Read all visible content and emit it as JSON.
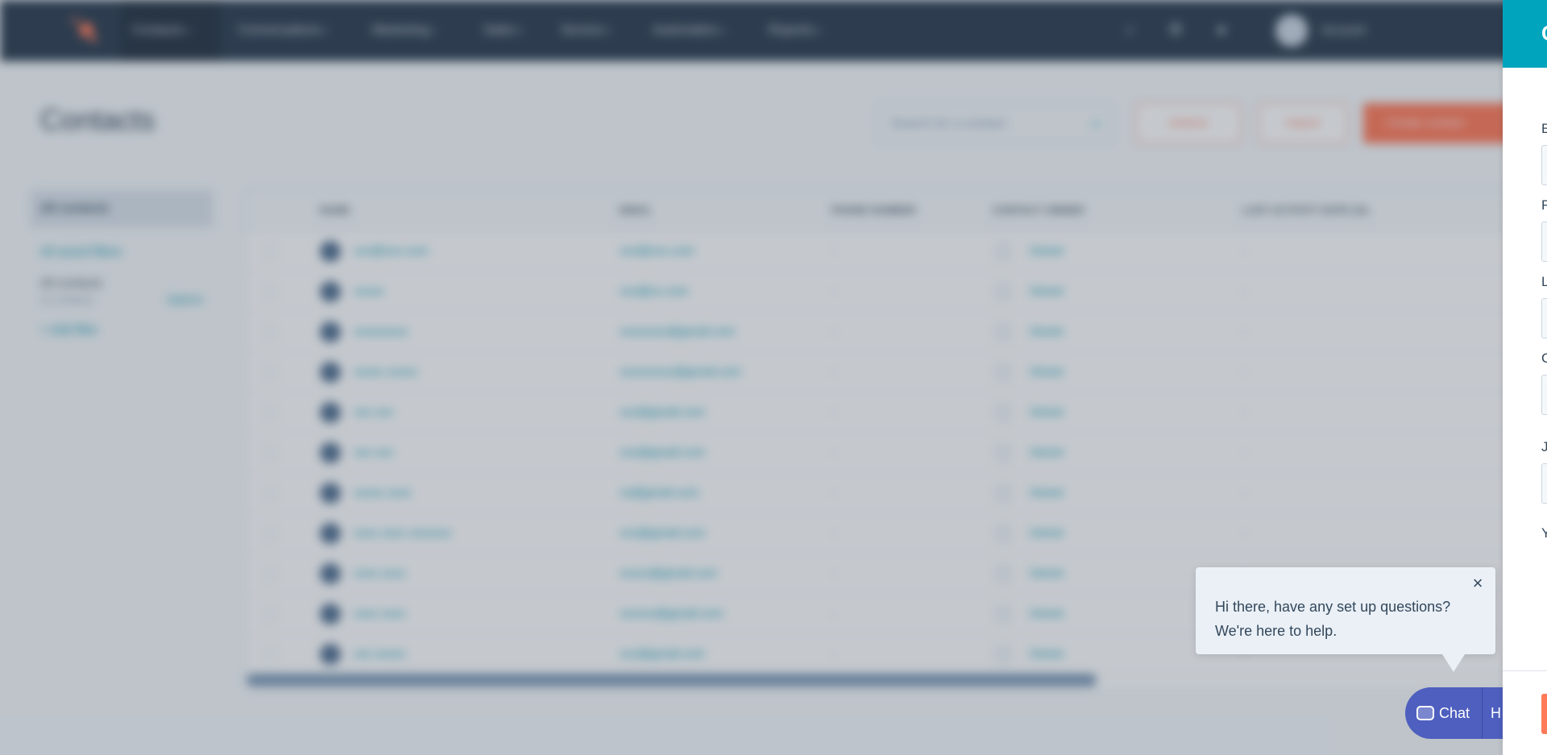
{
  "app": {
    "nav": {
      "items": [
        {
          "label": "Contacts"
        },
        {
          "label": "Conversations"
        },
        {
          "label": "Marketing"
        },
        {
          "label": "Sales"
        },
        {
          "label": "Service"
        },
        {
          "label": "Automation"
        },
        {
          "label": "Reports"
        }
      ],
      "account_label": "Account"
    },
    "page_title": "Contacts",
    "search_placeholder": "Search for a contact",
    "actions_label": "Actions",
    "import_label": "Import",
    "create_label": "Create contact",
    "left_panel": {
      "view_all": "All contacts",
      "saved_filters": "All saved filters",
      "filter_title": "All contacts",
      "filter_count": "11 contacts",
      "options": "Options",
      "add_filter": "+ Add filter"
    },
    "table": {
      "headers": [
        "NAME",
        "EMAIL",
        "PHONE NUMBER",
        "CONTACT OWNER",
        "LAST ACTIVITY DATE (GL"
      ],
      "rows": [
        {
          "name": "xxx@xxx.com",
          "email": "xxx@xxx.com",
          "phone": "-",
          "owner": "Owner",
          "activity": "-"
        },
        {
          "name": "xxxxx",
          "email": "xxx@xx.com",
          "phone": "-",
          "owner": "Owner",
          "activity": "-"
        },
        {
          "name": "xxxxxxxxx",
          "email": "xxxxxxxx@gmail.com",
          "phone": "-",
          "owner": "Owner",
          "activity": "-"
        },
        {
          "name": "xxxxx xxxxx",
          "email": "xxxxxxxxx@gmail.com",
          "phone": "-",
          "owner": "Owner",
          "activity": "-"
        },
        {
          "name": "xxx xxx",
          "email": "xxx@gmail.com",
          "phone": "-",
          "owner": "Owner",
          "activity": "-"
        },
        {
          "name": "xxx xxx",
          "email": "xxx@gmail.com",
          "phone": "-",
          "owner": "Owner",
          "activity": "-"
        },
        {
          "name": "xxxxx xxxx",
          "email": "xx@gmail.com",
          "phone": "-",
          "owner": "Owner",
          "activity": "-"
        },
        {
          "name": "xxxx xxxx xxxxxxx",
          "email": "xxx@gmail.com",
          "phone": "-",
          "owner": "Owner",
          "activity": "-"
        },
        {
          "name": "xxxx xxxx",
          "email": "xxxxx@gmail.com",
          "phone": "-",
          "owner": "Owner",
          "activity": "-"
        },
        {
          "name": "xxxx xxxx",
          "email": "xxxxxx@gmail.com",
          "phone": "-",
          "owner": "Owner",
          "activity": "-"
        },
        {
          "name": "xxx xxxxx",
          "email": "xxx@gmail.com",
          "phone": "-",
          "owner": "Owner",
          "activity": "-"
        }
      ]
    }
  },
  "chat": {
    "message_line1": "Hi there, have any set up questions?",
    "message_line2": "We're here to help.",
    "close_glyph": "×",
    "chat_label": "Chat",
    "help_label": "H"
  },
  "panel": {
    "title": "C",
    "field_labels": [
      "E",
      "F",
      "L",
      "C",
      "J",
      "Y"
    ]
  },
  "colors": {
    "nav_bg": "#2d3e50",
    "accent_teal": "#00a4bd",
    "accent_orange": "#ff7a59",
    "chat_blue": "#4e5fbf"
  }
}
